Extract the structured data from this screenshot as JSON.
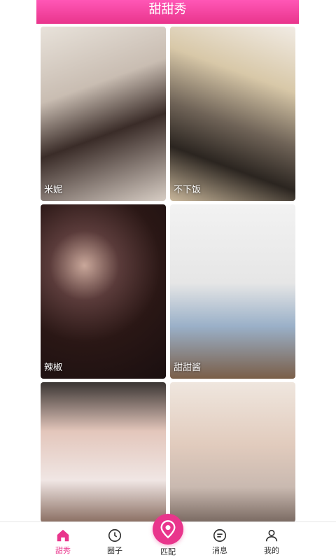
{
  "header": {
    "title": "甜甜秀"
  },
  "feed": {
    "items": [
      {
        "name": "米妮"
      },
      {
        "name": "不下饭"
      },
      {
        "name": "辣椒"
      },
      {
        "name": "甜甜酱"
      },
      {
        "name": ""
      },
      {
        "name": ""
      }
    ]
  },
  "tabbar": {
    "tabs": [
      {
        "label": "甜秀",
        "icon": "home-icon",
        "active": true
      },
      {
        "label": "圈子",
        "icon": "clock-icon",
        "active": false
      },
      {
        "label": "匹配",
        "icon": "location-pin-icon",
        "active": false
      },
      {
        "label": "消息",
        "icon": "message-icon",
        "active": false
      },
      {
        "label": "我的",
        "icon": "user-icon",
        "active": false
      }
    ]
  },
  "colors": {
    "accent": "#e9358c",
    "header_gradient_start": "#ff57b6"
  }
}
